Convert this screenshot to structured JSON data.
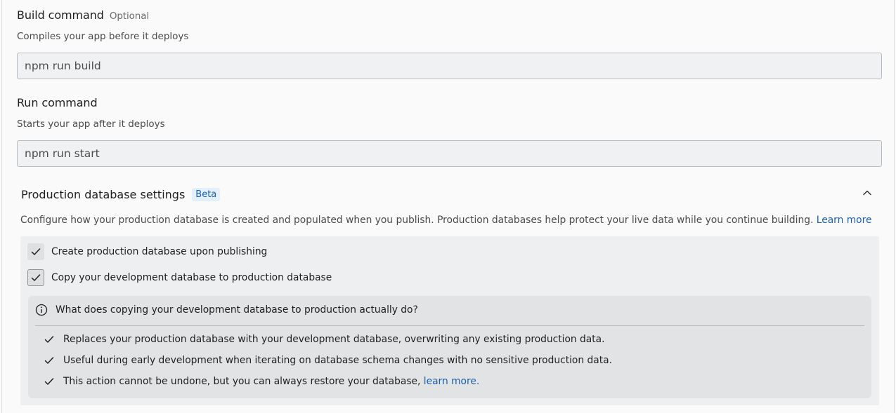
{
  "build": {
    "title": "Build command",
    "optional": "Optional",
    "description": "Compiles your app before it deploys",
    "value": "npm run build"
  },
  "run": {
    "title": "Run command",
    "description": "Starts your app after it deploys",
    "value": "npm run start"
  },
  "db_settings": {
    "title": "Production database settings",
    "badge": "Beta",
    "description": "Configure how your production database is created and populated when you publish. Production databases help protect your live data while you continue building.",
    "learn_more": "Learn more",
    "checkboxes": [
      {
        "label": "Create production database upon publishing",
        "checked": true
      },
      {
        "label": "Copy your development database to production database",
        "checked": true
      }
    ],
    "info": {
      "question": "What does copying your development database to production actually do?",
      "points": [
        "Replaces your production database with your development database, overwriting any existing production data.",
        "Useful during early development when iterating on database schema changes with no sensitive production data.",
        "This action cannot be undone, but you can always restore your database,"
      ],
      "restore_link": "learn more."
    }
  },
  "icons": {
    "collapse": "chevron-up-icon",
    "checkmark": "check-icon",
    "info": "info-icon"
  },
  "colors": {
    "accent": "#1d5fa8",
    "badge_bg": "#e3f0fb",
    "panel_bg": "#eeeff0",
    "info_bg": "#e2e3e5"
  }
}
